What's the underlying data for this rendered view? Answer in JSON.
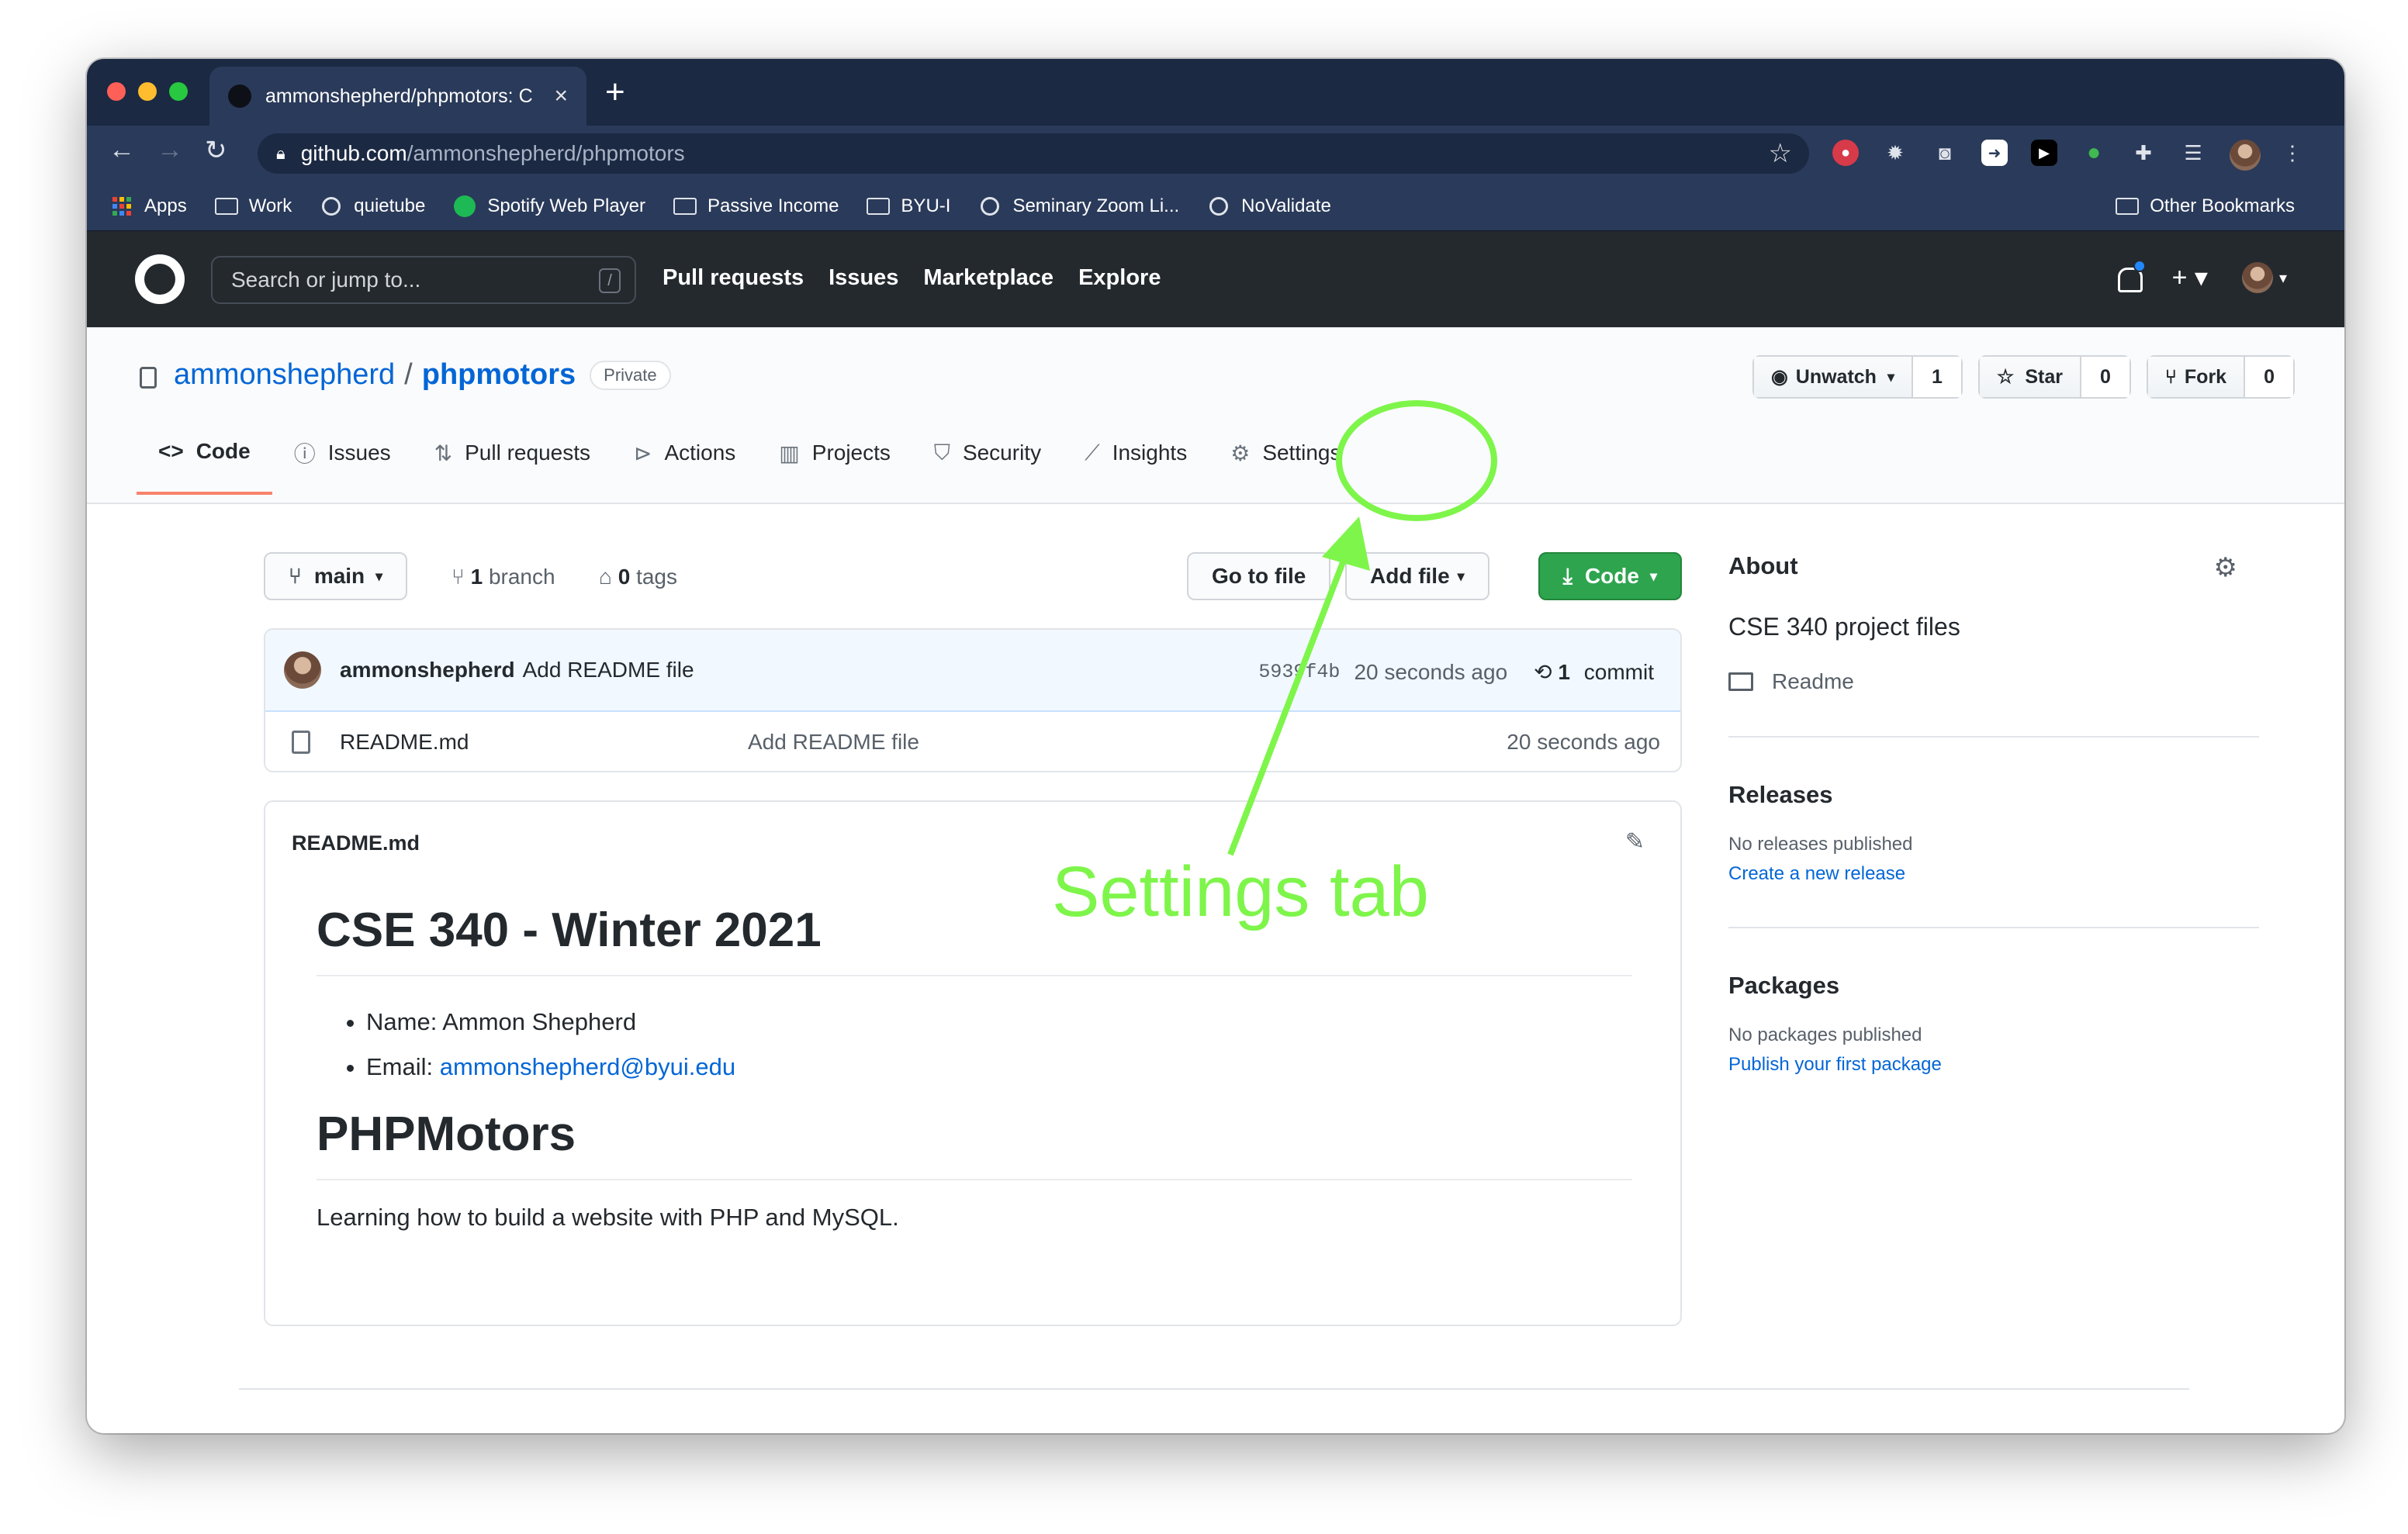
{
  "browser": {
    "tab_title": "ammonshepherd/phpmotors: C",
    "tab_close": "×",
    "new_tab": "+",
    "url_domain": "github.com",
    "url_path": "/ammonshepherd/phpmotors",
    "bookmarks": [
      "Apps",
      "Work",
      "quietube",
      "Spotify Web Player",
      "Passive Income",
      "BYU-I",
      "Seminary Zoom Li...",
      "NoValidate"
    ],
    "other_bookmarks": "Other Bookmarks"
  },
  "github": {
    "search_placeholder": "Search or jump to...",
    "search_key": "/",
    "nav": [
      "Pull requests",
      "Issues",
      "Marketplace",
      "Explore"
    ]
  },
  "repo": {
    "owner": "ammonshepherd",
    "separator": "/",
    "name": "phpmotors",
    "visibility": "Private",
    "watch_label": "Unwatch",
    "watch_count": "1",
    "star_label": "Star",
    "star_count": "0",
    "fork_label": "Fork",
    "fork_count": "0",
    "tabs": [
      "Code",
      "Issues",
      "Pull requests",
      "Actions",
      "Projects",
      "Security",
      "Insights",
      "Settings"
    ]
  },
  "code": {
    "branch": "main",
    "branch_count": "1",
    "branch_word": "branch",
    "tag_count": "0",
    "tag_word": "tags",
    "go_to_file": "Go to file",
    "add_file": "Add file",
    "code_button": "Code",
    "commit_author": "ammonshepherd",
    "commit_message": "Add README file",
    "commit_sha": "5939f4b",
    "commit_age": "20 seconds ago",
    "commit_count": "1",
    "commit_word": "commit",
    "files": [
      {
        "name": "README.md",
        "message": "Add README file",
        "age": "20 seconds ago"
      }
    ]
  },
  "readme": {
    "filename": "README.md",
    "h1": "CSE 340 - Winter 2021",
    "name_line": "Name: Ammon Shepherd",
    "email_label": "Email: ",
    "email": "ammonshepherd@byui.edu",
    "h1b": "PHPMotors",
    "paragraph": "Learning how to build a website with PHP and MySQL."
  },
  "sidebar": {
    "about": "About",
    "description": "CSE 340 project files",
    "readme": "Readme",
    "releases": "Releases",
    "no_releases": "No releases published",
    "create_release": "Create a new release",
    "packages": "Packages",
    "no_packages": "No packages published",
    "publish_package": "Publish your first package"
  },
  "annotation": {
    "label": "Settings tab",
    "color": "#7ef54a"
  }
}
